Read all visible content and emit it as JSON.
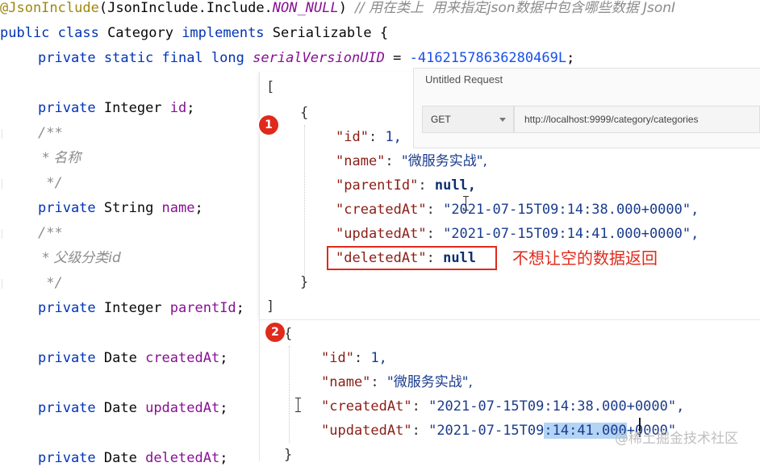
{
  "editor": {
    "line0": {
      "annotation": "@JsonInclude",
      "arg_class": "JsonInclude",
      "arg_member": ".Include.",
      "arg_const": "NON_NULL",
      "comment": "// 用在类上  用来指定json数据中包含哪些数据 JsonI"
    },
    "line1": {
      "kw": "public class",
      "name": " Category ",
      "kw2": "implements",
      "rest": " Serializable {"
    },
    "line2": {
      "kw": "private static final long",
      "field": "serialVersionUID",
      "eq": " = ",
      "value": "-41621578636280469L",
      "end": ";"
    },
    "line4": {
      "kw": "private",
      "type": " Integer ",
      "field": "id",
      "end": ";"
    },
    "line5": {
      "text": "/**"
    },
    "line6": {
      "text": " * 名称"
    },
    "line7": {
      "text": " */"
    },
    "line8": {
      "kw": "private",
      "type": " String ",
      "field": "name",
      "end": ";"
    },
    "line9": {
      "text": "/**"
    },
    "line10": {
      "text": " * 父级分类id"
    },
    "line11": {
      "text": " */"
    },
    "line12": {
      "kw": "private",
      "type": " Integer ",
      "field": "parentId",
      "end": ";"
    },
    "line14": {
      "kw": "private",
      "type": " Date ",
      "field": "createdAt",
      "end": ";"
    },
    "line16": {
      "kw": "private",
      "type": " Date ",
      "field": "updatedAt",
      "end": ";"
    },
    "line18": {
      "kw": "private",
      "type": " Date ",
      "field": "deletedAt",
      "end": ";"
    }
  },
  "request": {
    "title": "Untitled Request",
    "method": "GET",
    "url": "http://localhost:9999/category/categories"
  },
  "response1": {
    "badge": "1",
    "open_bracket": "[",
    "open_brace": "{",
    "id_key": "\"id\"",
    "id_val": "1,",
    "name_key": "\"name\"",
    "name_val": "\"微服务实战\",",
    "parent_key": "\"parentId\"",
    "parent_val": "null,",
    "created_key": "\"createdAt\"",
    "created_val": "\"2021-07-15T09:14:38.000+0000\",",
    "updated_key": "\"updatedAt\"",
    "updated_val": "\"2021-07-15T09:14:41.000+0000\",",
    "deleted_key": "\"deletedAt\"",
    "deleted_val": "null",
    "close_brace": "}",
    "close_bracket": "]",
    "note": "不想让空的数据返回"
  },
  "response2": {
    "badge": "2",
    "open_brace": "{",
    "id_key": "\"id\"",
    "id_val": "1,",
    "name_key": "\"name\"",
    "name_val": "\"微服务实战\",",
    "created_key": "\"createdAt\"",
    "created_val": "\"2021-07-15T09:14:38.000+0000\",",
    "updated_key": "\"updatedAt\"",
    "updated_val_pre": "\"2021-07-15T09",
    "updated_val_sel": ":14:41.000",
    "updated_val_post": "+0000\"",
    "close_brace": "}"
  },
  "watermark": "@稀土掘金技术社区",
  "colors": {
    "annotation": "#9e880d",
    "keyword": "#0033b3",
    "field": "#871094",
    "highlight_red": "#e02a1c",
    "selection": "#b3d4f5"
  }
}
